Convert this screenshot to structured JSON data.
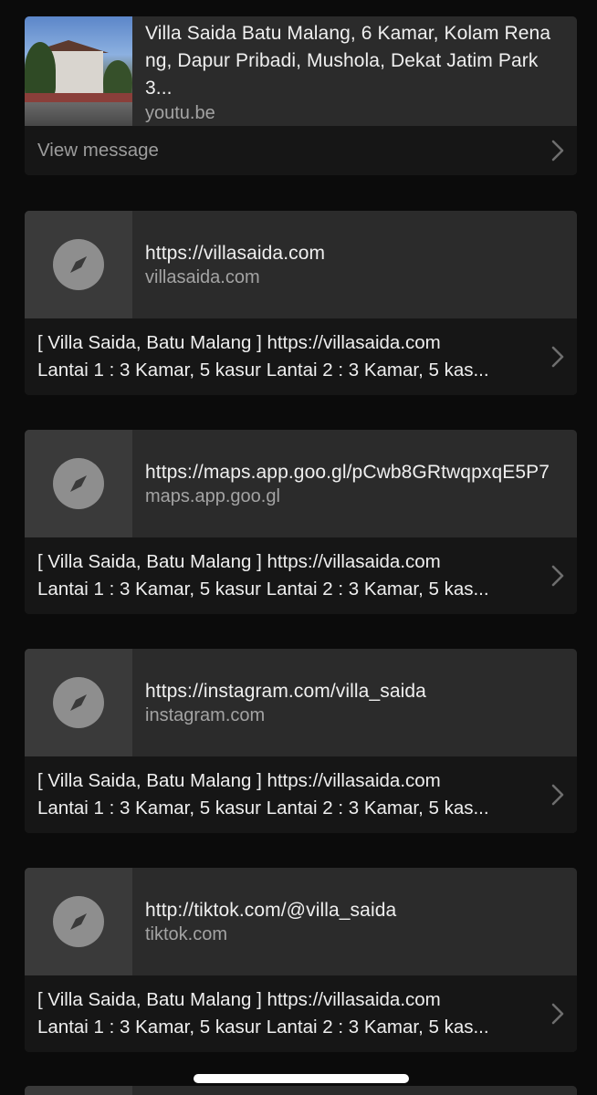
{
  "cards": [
    {
      "title": "Villa Saida Batu Malang, 6 Kamar, Kolam Renang, Dapur Pribadi, Mushola, Dekat Jatim Park 3...",
      "domain": "youtu.be",
      "action_label": "View message"
    },
    {
      "title": "https://villasaida.com",
      "domain": "villasaida.com",
      "message_line1": "[ Villa Saida, Batu Malang ]  https://villasaida.com",
      "message_line2": "Lantai 1 : 3 Kamar, 5 kasur Lantai 2 : 3 Kamar, 5 kas..."
    },
    {
      "title": "https://maps.app.goo.gl/pCwb8GRtwqpxqE5P7",
      "domain": "maps.app.goo.gl",
      "message_line1": "[ Villa Saida, Batu Malang ]  https://villasaida.com",
      "message_line2": "Lantai 1 : 3 Kamar, 5 kasur Lantai 2 : 3 Kamar, 5 kas..."
    },
    {
      "title": "https://instagram.com/villa_saida",
      "domain": "instagram.com",
      "message_line1": "[ Villa Saida, Batu Malang ]  https://villasaida.com",
      "message_line2": "Lantai 1 : 3 Kamar, 5 kasur Lantai 2 : 3 Kamar, 5 kas..."
    },
    {
      "title": "http://tiktok.com/@villa_saida",
      "domain": "tiktok.com",
      "message_line1": "[ Villa Saida, Batu Malang ]  https://villasaida.com",
      "message_line2": "Lantai 1 : 3 Kamar, 5 kasur Lantai 2 : 3 Kamar, 5 kas..."
    }
  ],
  "icons": {
    "link_placeholder": "compass-icon",
    "disclosure": "chevron-right-icon"
  },
  "colors": {
    "background": "#0b0b0b",
    "card_top": "#2b2b2b",
    "card_bottom": "#161616",
    "text_primary": "#efefef",
    "text_secondary": "#a3a3a3"
  }
}
